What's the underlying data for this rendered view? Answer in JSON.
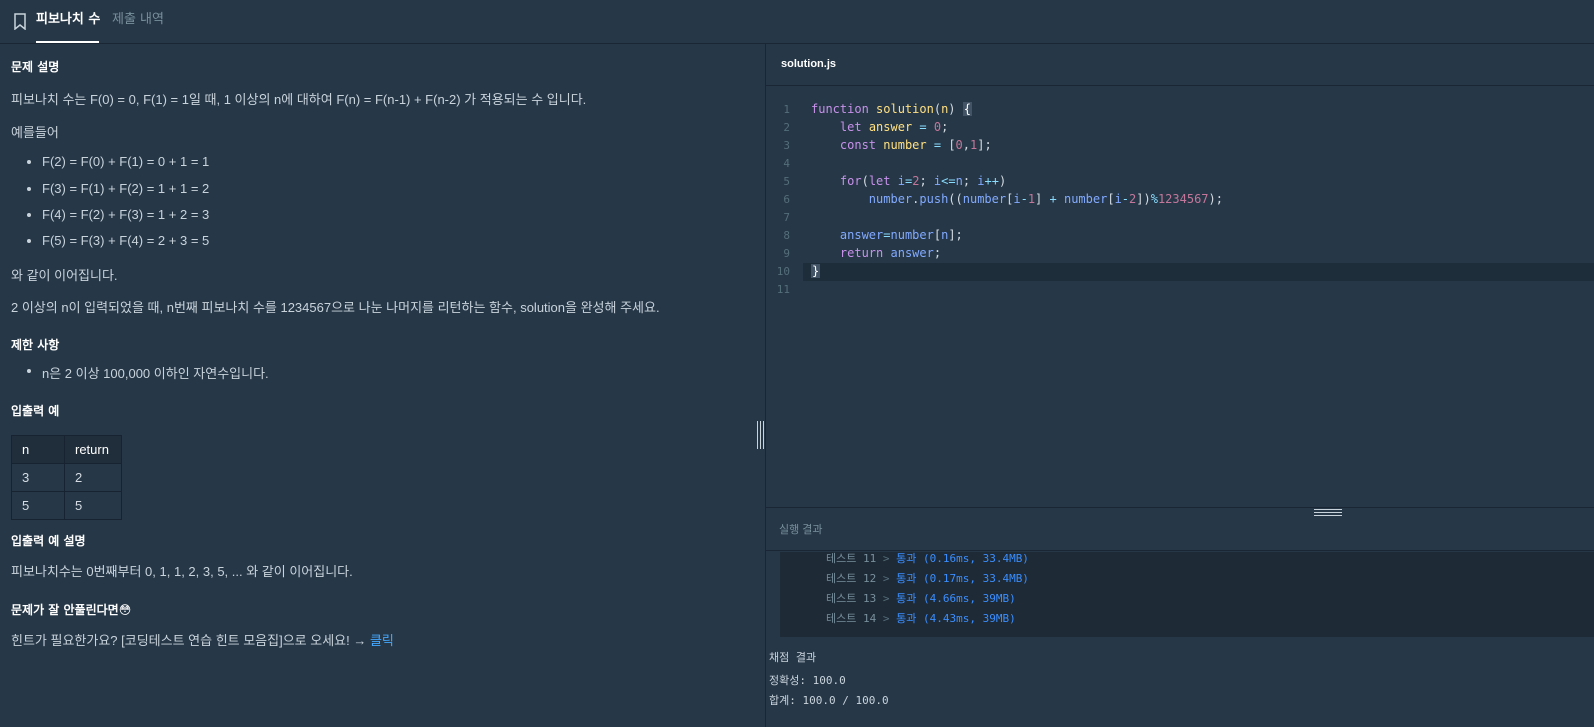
{
  "tabs": {
    "problem": "피보나치 수",
    "history": "제출 내역"
  },
  "problem": {
    "section_desc": "문제 설명",
    "desc_line": "피보나치 수는 F(0) = 0, F(1) = 1일 때, 1 이상의 n에 대하여 F(n) = F(n-1) + F(n-2) 가 적용되는 수 입니다.",
    "example_intro": "예를들어",
    "examples": [
      "F(2) = F(0) + F(1) = 0 + 1 = 1",
      "F(3) = F(1) + F(2) = 1 + 1 = 2",
      "F(4) = F(2) + F(3) = 1 + 2 = 3",
      "F(5) = F(3) + F(4) = 2 + 3 = 5"
    ],
    "continue": "와 같이 이어집니다.",
    "task": "2 이상의 n이 입력되었을 때, n번째 피보나치 수를 1234567으로 나눈 나머지를 리턴하는 함수, solution을 완성해 주세요.",
    "section_limits": "제한 사항",
    "limit": "n은 2 이상 100,000 이하인 자연수입니다.",
    "section_io": "입출력 예",
    "table_headers": [
      "n",
      "return"
    ],
    "table_rows": [
      [
        "3",
        "2"
      ],
      [
        "5",
        "5"
      ]
    ],
    "section_io_desc": "입출력 예 설명",
    "io_desc": "피보나치수는 0번째부터 0, 1, 1, 2, 3, 5, ... 와 같이 이어집니다.",
    "section_help": "문제가 잘 안풀린다면😳",
    "help_text": "힌트가 필요한가요? [코딩테스트 연습 힌트 모음집]으로 오세요! → ",
    "help_link": "클릭"
  },
  "editor": {
    "filename": "solution.js",
    "line_numbers": [
      "1",
      "2",
      "3",
      "4",
      "5",
      "6",
      "7",
      "8",
      "9",
      "10",
      "11"
    ]
  },
  "results": {
    "title": "실행 결과",
    "tests": [
      {
        "name": "테스트 11",
        "result": "통과 (0.16ms, 33.4MB)"
      },
      {
        "name": "테스트 12",
        "result": "통과 (0.17ms, 33.4MB)"
      },
      {
        "name": "테스트 13",
        "result": "통과 (4.66ms, 39MB)"
      },
      {
        "name": "테스트 14",
        "result": "통과 (4.43ms, 39MB)"
      }
    ],
    "score_title": "채점 결과",
    "accuracy": "정확성: 100.0",
    "total": "합계: 100.0 / 100.0"
  },
  "colors": {
    "background": "#263747",
    "accent_link": "#44a8ff",
    "pass": "#3a8eff"
  }
}
